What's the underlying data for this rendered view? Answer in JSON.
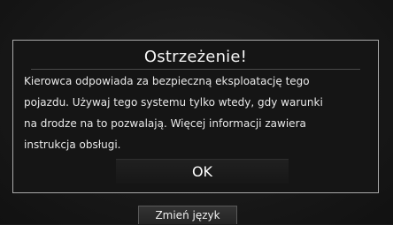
{
  "dialog": {
    "title": "Ostrzeżenie!",
    "message": "Kierowca odpowiada za bezpieczną eksploatację tego\npojazdu. Używaj tego systemu tylko wtedy, gdy warunki\nna drodze na to pozwalają. Więcej informacji zawiera\ninstrukcja obsługi.",
    "ok_label": "OK"
  },
  "footer": {
    "change_language_label": "Zmień język"
  }
}
